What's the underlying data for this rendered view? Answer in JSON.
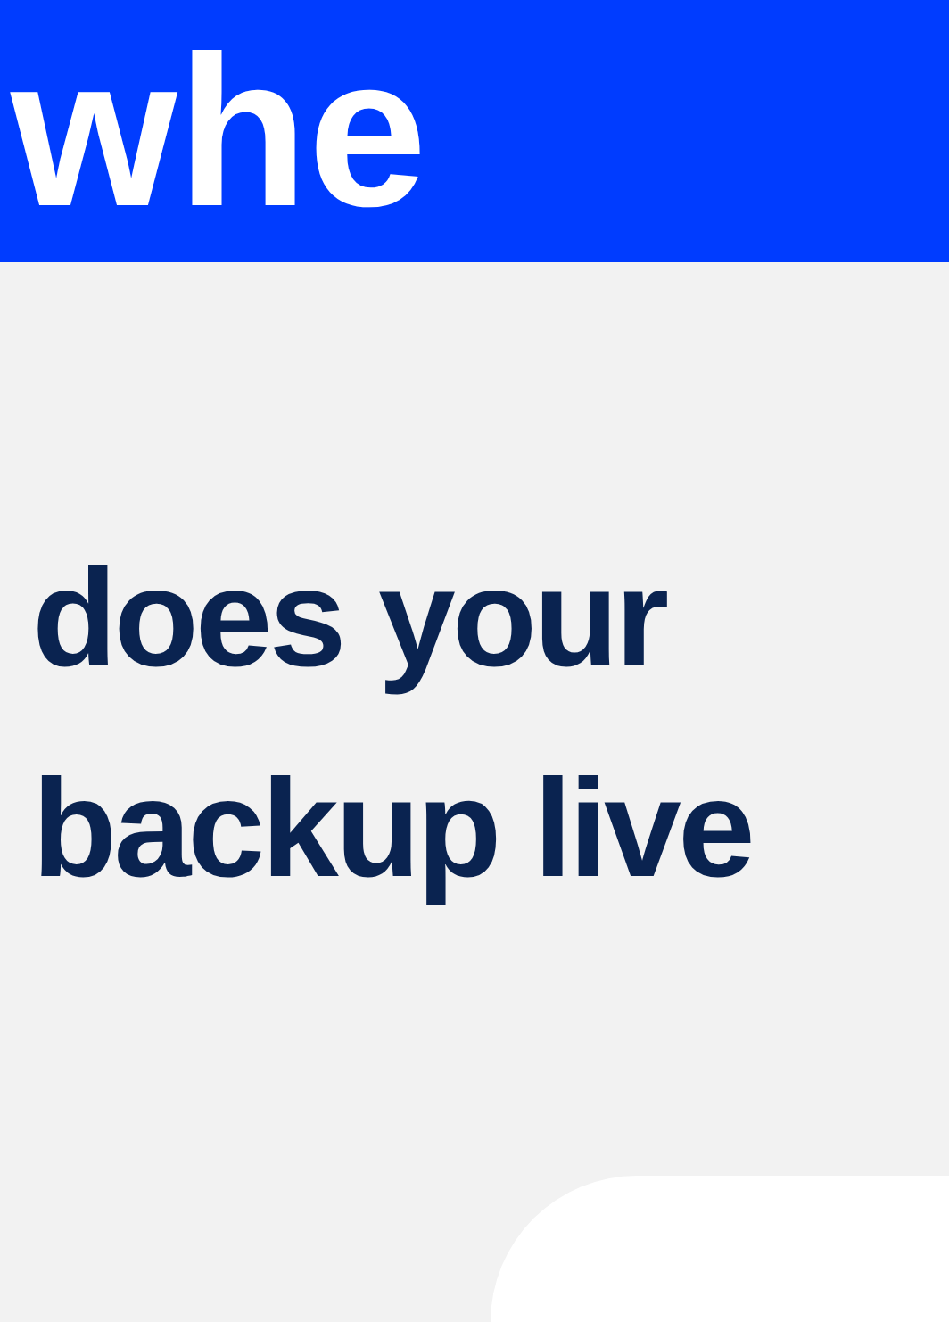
{
  "banner": {
    "text": "whe"
  },
  "heading": "does your backup live"
}
